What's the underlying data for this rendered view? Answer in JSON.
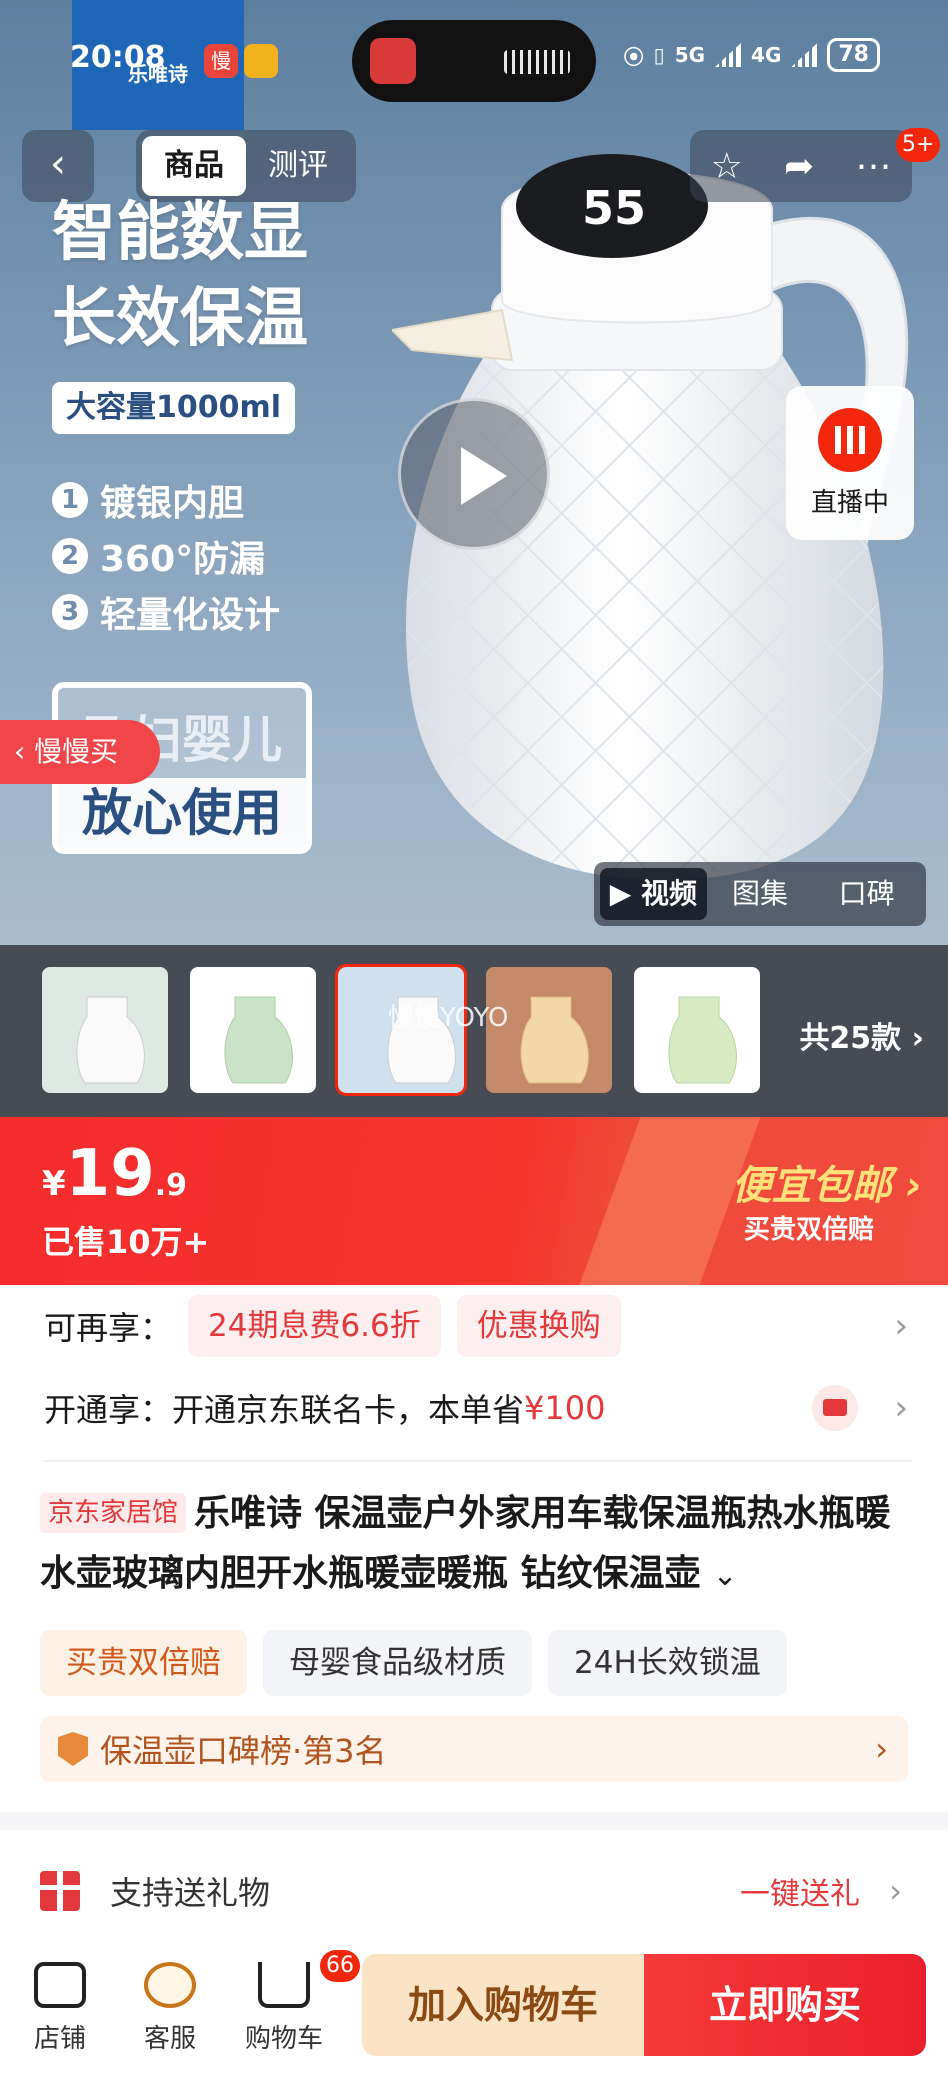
{
  "status_bar": {
    "time": "20:08",
    "network_1": "5G",
    "network_2": "4G",
    "battery": "78"
  },
  "overlay_chip": {
    "brand": "乐唯诗",
    "mini_app": "慢"
  },
  "nav": {
    "back_icon": "chevron-left-icon",
    "tabs": [
      {
        "label": "商品",
        "active": true
      },
      {
        "label": "测评",
        "active": false
      }
    ],
    "message_badge": "5+"
  },
  "hero": {
    "title_line1": "智能数显",
    "title_line2": "长效保温",
    "capacity": "大容量1000ml",
    "features": [
      {
        "num": "1",
        "text": "镀银内胆"
      },
      {
        "num": "2",
        "text": "360°防漏"
      },
      {
        "num": "3",
        "text": "轻量化设计"
      }
    ],
    "promo_line1": "孕妇婴儿",
    "promo_line2": "放心使用",
    "live_label": "直播中",
    "slow_buy": "慢慢买",
    "media_tabs": [
      {
        "label": "▶ 视频",
        "active": true
      },
      {
        "label": "图集",
        "active": false
      },
      {
        "label": "口碑",
        "active": false
      }
    ]
  },
  "thumbnails": {
    "watermark": "慢慢YOYO",
    "total": "共25款",
    "colors": [
      "#dfe9e4",
      "#c9e3c6",
      "#cfe0ef",
      "#f4d7a8",
      "#d6eac4"
    ]
  },
  "price": {
    "currency": "¥",
    "integer": "19",
    "decimal": ".9",
    "sold": "已售10万+",
    "cheap_ship": "便宜包邮",
    "double_comp": "买贵双倍赔"
  },
  "benefits": {
    "row1_label": "可再享：",
    "row1_tags": [
      "24期息费6.6折",
      "优惠换购"
    ],
    "row2_label": "开通享：",
    "row2_text": "开通京东联名卡，本单省",
    "row2_amount": "¥100"
  },
  "product": {
    "shop_tag": "京东家居馆",
    "title": "乐唯诗 保温壶户外家用车载保温瓶热水瓶暖水壶玻璃内胆开水瓶暖壶暖瓶 钻纹保温壶"
  },
  "chips": [
    "买贵双倍赔",
    "母婴食品级材质",
    "24H长效锁温"
  ],
  "rank": {
    "text": "保温壶口碑榜·第3名"
  },
  "gift": {
    "label": "支持送礼物",
    "action": "一键送礼"
  },
  "bottom_bar": {
    "shop": "店铺",
    "service": "客服",
    "cart": "购物车",
    "cart_count": "66",
    "add_cart": "加入购物车",
    "buy_now": "立即购买"
  },
  "colors": {
    "accent": "#f2270c",
    "price_banner": "#f42c2c",
    "cart_button": "#fbe4c5"
  }
}
